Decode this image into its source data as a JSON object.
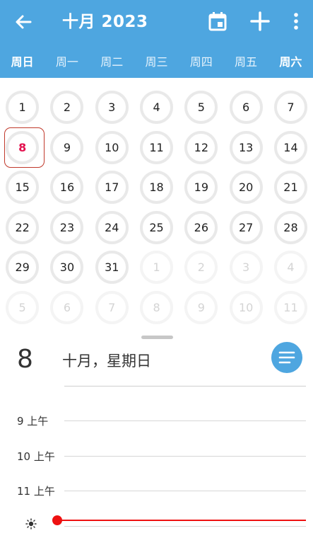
{
  "appbar": {
    "title": "十月 2023",
    "back_icon": "arrow-left-icon",
    "today_icon": "calendar-today-icon",
    "add_icon": "plus-icon",
    "more_icon": "more-vertical-icon",
    "color": "#4ea6e0"
  },
  "weekdays": [
    "周日",
    "周一",
    "周二",
    "周三",
    "周四",
    "周五",
    "周六"
  ],
  "month_days": [
    [
      "1",
      "2",
      "3",
      "4",
      "5",
      "6",
      "7"
    ],
    [
      "8",
      "9",
      "10",
      "11",
      "12",
      "13",
      "14"
    ],
    [
      "15",
      "16",
      "17",
      "18",
      "19",
      "20",
      "21"
    ],
    [
      "22",
      "23",
      "24",
      "25",
      "26",
      "27",
      "28"
    ],
    [
      "29",
      "30",
      "31",
      "1",
      "2",
      "3",
      "4"
    ],
    [
      "5",
      "6",
      "7",
      "8",
      "9",
      "10",
      "11"
    ]
  ],
  "today": "8",
  "day_view": {
    "day_number": "8",
    "date_text": "十月，星期日",
    "hours": [
      "9 上午",
      "10 上午",
      "11 上午"
    ],
    "fab_icon": "agenda-list-icon",
    "now_indicator_color": "#ee1111",
    "sun_icon": "sun-icon"
  }
}
